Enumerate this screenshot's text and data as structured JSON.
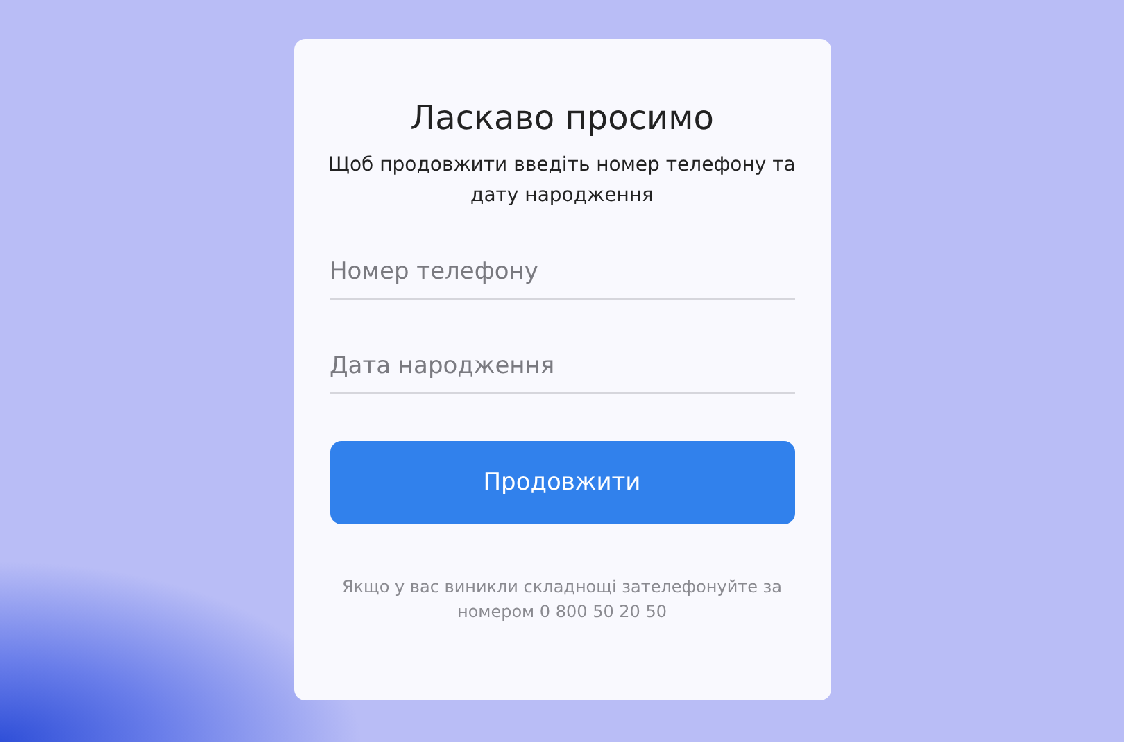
{
  "title": "Ласкаво просимо",
  "subtitle": "Щоб продовжити введіть номер телефону та дату народження",
  "fields": [
    {
      "placeholder": "Номер телефону"
    },
    {
      "placeholder": "Дата народження"
    }
  ],
  "button": "Продовжити",
  "footer": "Якщо у вас виникли складнощі зателефонуйте за номером 0 800 50 20 50"
}
